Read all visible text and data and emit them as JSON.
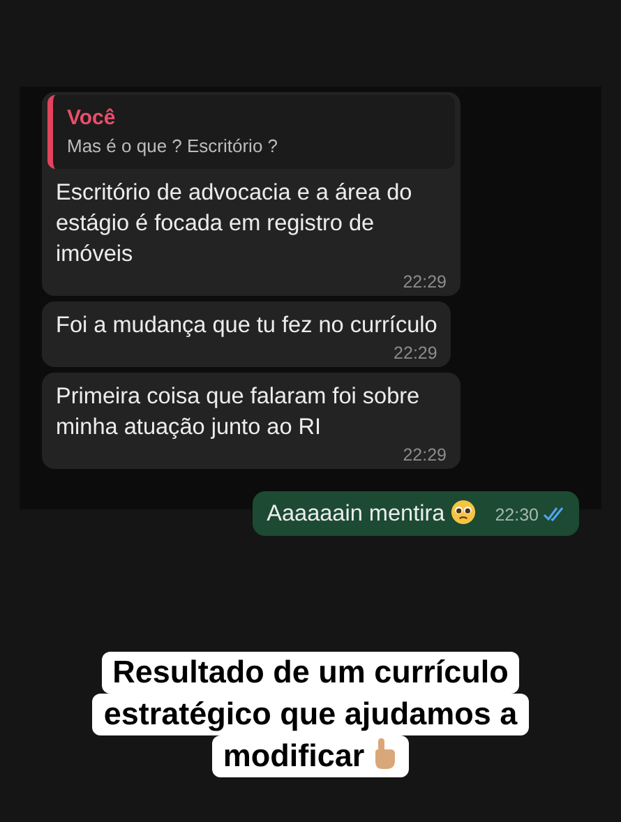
{
  "chat": {
    "messages": [
      {
        "kind": "incoming",
        "quote": {
          "author": "Você",
          "text": "Mas é o que ? Escritório ?"
        },
        "text": "Escritório de advocacia e a área do estágio é focada em registro de imóveis",
        "time": "22:29"
      },
      {
        "kind": "incoming",
        "text": "Foi a mudança que tu fez no currículo",
        "time": "22:29"
      },
      {
        "kind": "incoming",
        "text": "Primeira coisa que falaram foi sobre minha atuação junto ao RI",
        "time": "22:29"
      },
      {
        "kind": "outgoing",
        "text": "Aaaaaain mentira",
        "emoji": true,
        "time": "22:30",
        "read": true
      }
    ]
  },
  "caption": {
    "lines": [
      "Resultado de um currículo",
      "estratégico que ajudamos a",
      "modificar"
    ],
    "emoji": true
  }
}
